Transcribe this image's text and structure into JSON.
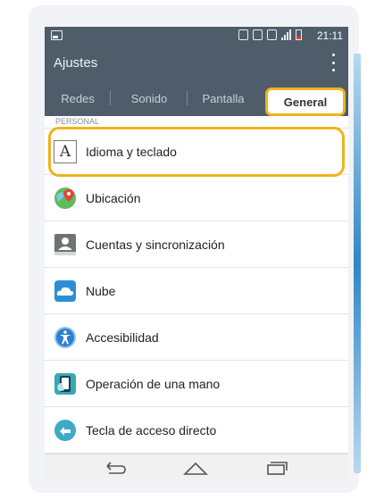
{
  "status_bar": {
    "time": "21:11"
  },
  "action_bar": {
    "title": "Ajustes"
  },
  "tabs": [
    {
      "label": "Redes"
    },
    {
      "label": "Sonido"
    },
    {
      "label": "Pantalla"
    },
    {
      "label": "General"
    }
  ],
  "selected_tab": "General",
  "section": {
    "header": "PERSONAL"
  },
  "items": [
    {
      "label": "Idioma y teclado",
      "icon": "language-icon"
    },
    {
      "label": "Ubicación",
      "icon": "location-icon"
    },
    {
      "label": "Cuentas y sincronización",
      "icon": "accounts-icon"
    },
    {
      "label": "Nube",
      "icon": "cloud-icon"
    },
    {
      "label": "Accesibilidad",
      "icon": "accessibility-icon"
    },
    {
      "label": "Operación de una mano",
      "icon": "one-hand-icon"
    },
    {
      "label": "Tecla de acceso directo",
      "icon": "shortcut-key-icon"
    }
  ],
  "colors": {
    "header": "#4f5d6a",
    "highlight": "#f2b21c",
    "accent_blue": "#2c8fd6"
  }
}
